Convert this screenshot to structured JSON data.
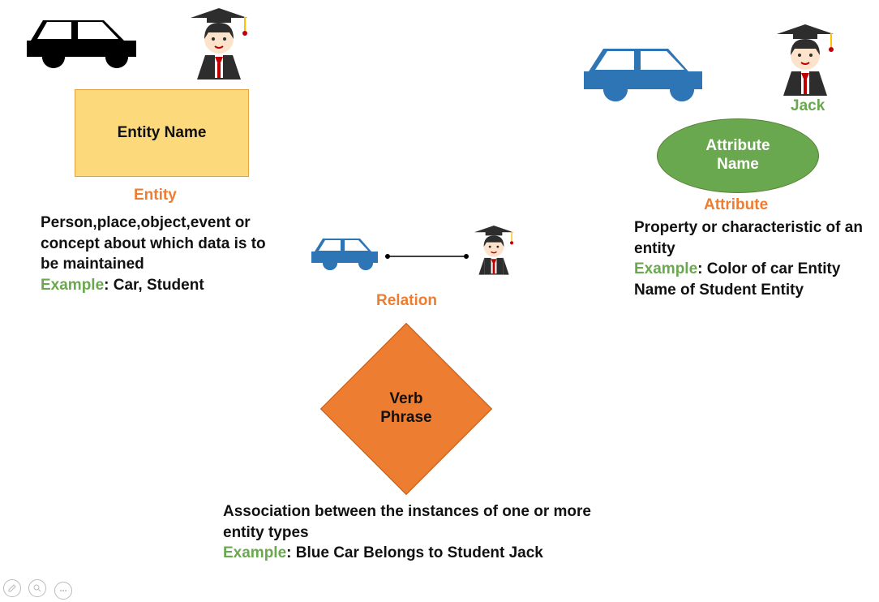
{
  "entity": {
    "box_label": "Entity Name",
    "heading": "Entity",
    "description": "Person,place,object,event or concept about which data is to be maintained",
    "example_label": "Example",
    "example_text": ": Car, Student"
  },
  "attribute": {
    "name_label": "Jack",
    "ellipse_label": "Attribute Name",
    "heading": "Attribute",
    "description": "Property or characteristic of an entity",
    "example_label": "Example",
    "example_text": ": Color of car Entity Name of Student Entity"
  },
  "relation": {
    "heading": "Relation",
    "diamond_label": "Verb Phrase",
    "description": "Association between the instances of one or more entity types",
    "example_label": "Example",
    "example_text": ": Blue Car Belongs to Student Jack"
  },
  "icons": {
    "car_black": "car-icon",
    "car_blue": "car-icon",
    "student": "student-icon"
  }
}
